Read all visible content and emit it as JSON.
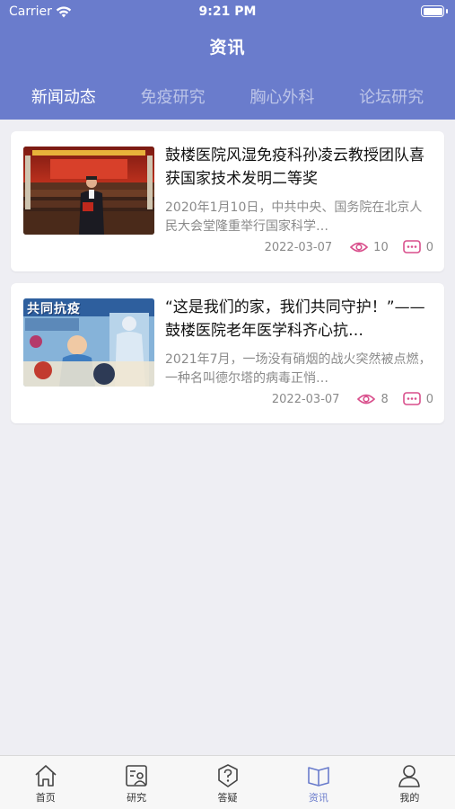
{
  "status_bar": {
    "carrier": "Carrier",
    "time": "9:21 PM"
  },
  "header": {
    "title": "资讯"
  },
  "tabs": [
    {
      "label": "新闻动态",
      "active": true
    },
    {
      "label": "免疫研究",
      "active": false
    },
    {
      "label": "胸心外科",
      "active": false
    },
    {
      "label": "论坛研究",
      "active": false
    }
  ],
  "articles": [
    {
      "title": "鼓楼医院风湿免疫科孙凌云教授团队喜获国家技术发明二等奖",
      "summary": "2020年1月10日，中共中央、国务院在北京人民大会堂隆重举行国家科学…",
      "date": "2022-03-07",
      "views": "10",
      "comments": "0",
      "image": "award-ceremony-photo"
    },
    {
      "title": "“这是我们的家，我们共同守护！”——鼓楼医院老年医学科齐心抗…",
      "summary": "2021年7月，一场没有硝烟的战火突然被点燃，一种名叫德尔塔的病毒正悄…",
      "date": "2022-03-07",
      "views": "8",
      "comments": "0",
      "image": "anti-epidemic-illustration",
      "image_text": "共同抗疫"
    }
  ],
  "tabbar": [
    {
      "label": "首页",
      "icon": "home-icon",
      "active": false
    },
    {
      "label": "研究",
      "icon": "research-icon",
      "active": false
    },
    {
      "label": "答疑",
      "icon": "question-icon",
      "active": false
    },
    {
      "label": "资讯",
      "icon": "book-icon",
      "active": true
    },
    {
      "label": "我的",
      "icon": "user-icon",
      "active": false
    }
  ],
  "colors": {
    "accent": "#6a7ccc",
    "background": "#eeeef3",
    "icon_pink": "#d94f8c"
  }
}
